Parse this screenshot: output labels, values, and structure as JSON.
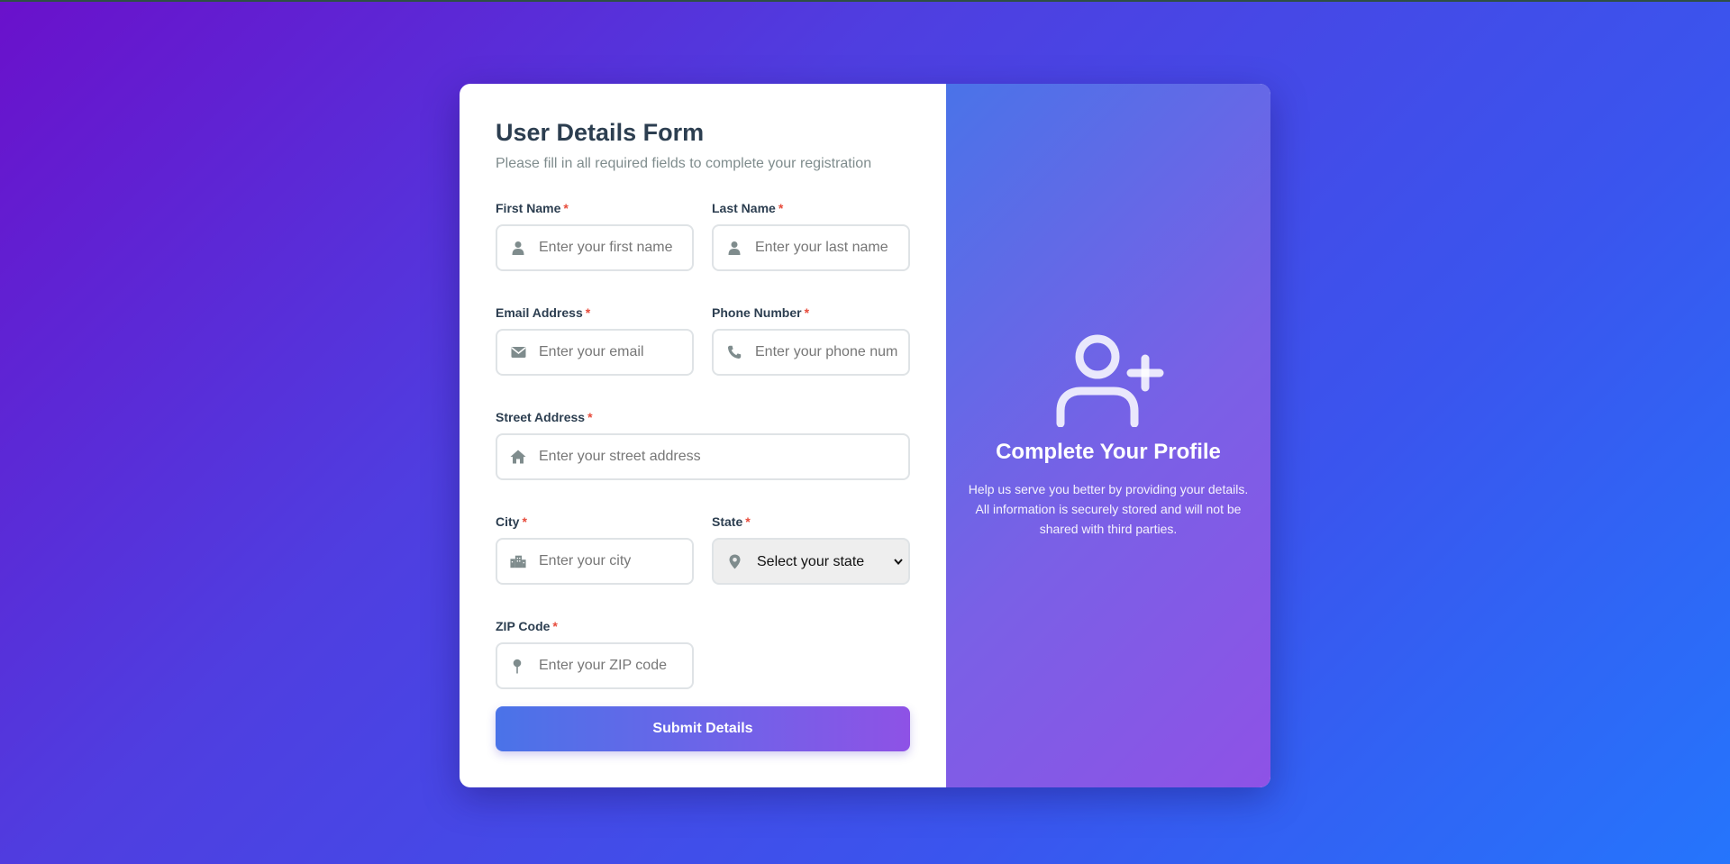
{
  "form": {
    "title": "User Details Form",
    "subtitle": "Please fill in all required fields to complete your registration",
    "required_mark": "*",
    "fields": {
      "first_name": {
        "label": "First Name",
        "placeholder": "Enter your first name",
        "icon": "user-icon"
      },
      "last_name": {
        "label": "Last Name",
        "placeholder": "Enter your last name",
        "icon": "user-icon"
      },
      "email": {
        "label": "Email Address",
        "placeholder": "Enter your email",
        "icon": "envelope-icon"
      },
      "phone": {
        "label": "Phone Number",
        "placeholder": "Enter your phone number",
        "icon": "phone-icon"
      },
      "street": {
        "label": "Street Address",
        "placeholder": "Enter your street address",
        "icon": "home-icon"
      },
      "city": {
        "label": "City",
        "placeholder": "Enter your city",
        "icon": "building-icon"
      },
      "state": {
        "label": "State",
        "selected": "Select your state",
        "icon": "map-marker-icon"
      },
      "zip": {
        "label": "ZIP Code",
        "placeholder": "Enter your ZIP code",
        "icon": "map-pin-icon"
      }
    },
    "submit_label": "Submit Details"
  },
  "info": {
    "icon": "user-plus-icon",
    "title": "Complete Your Profile",
    "text": "Help us serve you better by providing your details. All information is securely stored and will not be shared with third parties."
  },
  "colors": {
    "accent_start": "#4a73e8",
    "accent_end": "#8e52e6",
    "required": "#e74c3c",
    "heading": "#2c3e50",
    "muted": "#7f8c8d"
  }
}
